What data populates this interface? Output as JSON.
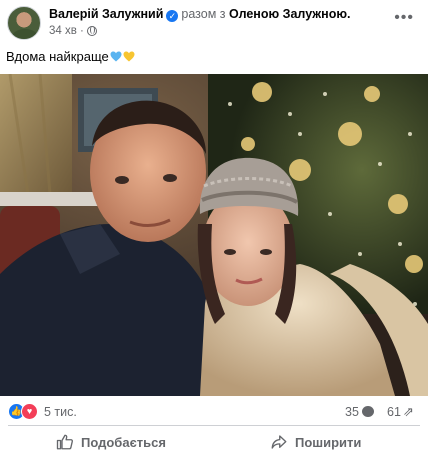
{
  "post": {
    "author": "Валерій Залужний",
    "with_prefix": "разом з",
    "tagged_person": "Оленою Залужною.",
    "time": "34 хв",
    "caption_text": "Вдома найкраще",
    "caption_emojis": [
      "blue-heart",
      "yellow-heart"
    ],
    "more_label": "•••"
  },
  "reactions": {
    "types": [
      "like",
      "love"
    ],
    "count": "5 тис.",
    "comments": "35",
    "shares": "61"
  },
  "actions": {
    "like_label": "Подобається",
    "share_label": "Поширити"
  },
  "icons": {
    "verified": "verified-badge-icon",
    "audience": "globe-icon",
    "like": "thumbs-up-icon",
    "share": "share-arrow-icon",
    "comment": "comment-bubble-icon"
  },
  "colors": {
    "brand_blue": "#1877f2",
    "love_red": "#f33e58",
    "muted_text": "#65676b",
    "heart_blue": "#5ab4f0",
    "heart_yellow": "#f7c531"
  }
}
